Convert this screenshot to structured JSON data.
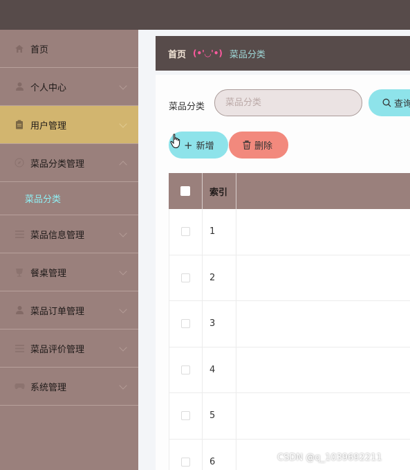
{
  "sidebar": {
    "items": [
      {
        "label": "首页",
        "icon": "home-icon",
        "chevron": "none"
      },
      {
        "label": "个人中心",
        "icon": "user-icon",
        "chevron": "down"
      },
      {
        "label": "用户管理",
        "icon": "clipboard-icon",
        "chevron": "down",
        "active": true
      },
      {
        "label": "菜品分类管理",
        "icon": "compass-icon",
        "chevron": "up"
      },
      {
        "label": "菜品信息管理",
        "icon": "list-icon",
        "chevron": "down"
      },
      {
        "label": "餐桌管理",
        "icon": "cup-icon",
        "chevron": "down"
      },
      {
        "label": "菜品订单管理",
        "icon": "user-icon",
        "chevron": "down"
      },
      {
        "label": "菜品评价管理",
        "icon": "list-icon",
        "chevron": "down"
      },
      {
        "label": "系统管理",
        "icon": "gamepad-icon",
        "chevron": "down"
      }
    ],
    "submenu_label": "菜品分类"
  },
  "breadcrumb": {
    "home": "首页",
    "face": "(•'◡'•)",
    "current": "菜品分类"
  },
  "search": {
    "label": "菜品分类",
    "placeholder": "菜品分类",
    "query_label": "查询"
  },
  "actions": {
    "add_label": "新增",
    "delete_label": "删除"
  },
  "table": {
    "header_index": "索引",
    "rows": [
      "1",
      "2",
      "3",
      "4",
      "5",
      "6"
    ]
  },
  "watermark": "CSDN @q_1039692211",
  "colors": {
    "topbar": "#574b4a",
    "sidebar": "#9a807c",
    "active_item": "#d2b56f",
    "submenu_text": "#8ff0f5",
    "primary_button": "#8ee3ea",
    "danger_button": "#f2897d",
    "breadcrumb_face": "#ff5aa0"
  }
}
